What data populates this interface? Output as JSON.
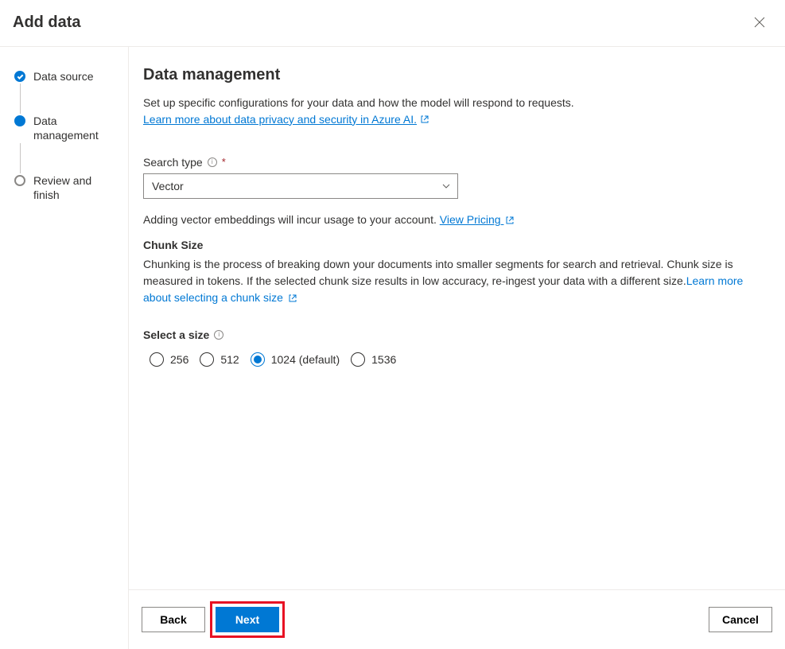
{
  "dialog": {
    "title": "Add data"
  },
  "stepper": {
    "items": [
      {
        "label": "Data source",
        "state": "completed"
      },
      {
        "label": "Data management",
        "state": "current"
      },
      {
        "label": "Review and finish",
        "state": "upcoming"
      }
    ]
  },
  "page": {
    "heading": "Data management",
    "description": "Set up specific configurations for your data and how the model will respond to requests.",
    "learn_more_label": "Learn more about data privacy and security in Azure AI."
  },
  "search_type": {
    "label": "Search type",
    "required_marker": "*",
    "selected": "Vector",
    "helper_prefix": "Adding vector embeddings will incur usage to your account. ",
    "pricing_link": "View Pricing"
  },
  "chunk": {
    "heading": "Chunk Size",
    "body_prefix": "Chunking is the process of breaking down your documents into smaller segments for search and retrieval. Chunk size is measured in tokens. If the selected chunk size results in low accuracy, re-ingest your data with a different size.",
    "learn_link": "Learn more about selecting a chunk size",
    "select_label": "Select a size",
    "options": [
      {
        "label": "256",
        "value": 256,
        "selected": false
      },
      {
        "label": "512",
        "value": 512,
        "selected": false
      },
      {
        "label": "1024 (default)",
        "value": 1024,
        "selected": true
      },
      {
        "label": "1536",
        "value": 1536,
        "selected": false
      }
    ]
  },
  "footer": {
    "back": "Back",
    "next": "Next",
    "cancel": "Cancel"
  }
}
